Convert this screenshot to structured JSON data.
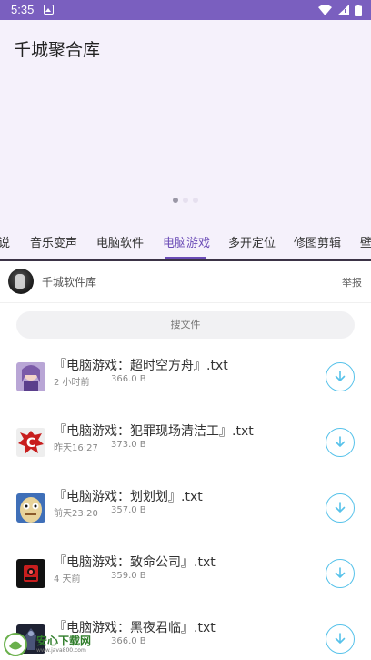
{
  "status_bar": {
    "time": "5:35",
    "icons": [
      "notification-icon",
      "wifi-icon",
      "signal-icon",
      "battery-icon"
    ]
  },
  "app": {
    "title": "千城聚合库"
  },
  "carousel": {
    "page_count": 3,
    "active_index": 0
  },
  "tabs": [
    {
      "label": "说",
      "active": false
    },
    {
      "label": "音乐变声",
      "active": false
    },
    {
      "label": "电脑软件",
      "active": false
    },
    {
      "label": "电脑游戏",
      "active": true
    },
    {
      "label": "多开定位",
      "active": false
    },
    {
      "label": "修图剪辑",
      "active": false
    },
    {
      "label": "壁",
      "active": false
    }
  ],
  "profile": {
    "name": "千城软件库",
    "report_label": "举报"
  },
  "search": {
    "placeholder": "搜文件"
  },
  "files": [
    {
      "name": "『电脑游戏：超时空方舟』.txt",
      "time": "2 小时前",
      "size": "366.0 B",
      "icon": "anime-girl-thumbnail"
    },
    {
      "name": "『电脑游戏：犯罪现场清洁工』.txt",
      "time": "昨天16:27",
      "size": "373.0 B",
      "icon": "red-c-splatter-thumbnail"
    },
    {
      "name": "『电脑游戏：划划划』.txt",
      "time": "前天23:20",
      "size": "357.0 B",
      "icon": "cartoon-face-thumbnail"
    },
    {
      "name": "『电脑游戏：致命公司』.txt",
      "time": "4 天前",
      "size": "359.0 B",
      "icon": "red-robot-thumbnail"
    },
    {
      "name": "『电脑游戏：黑夜君临』.txt",
      "time": "",
      "size": "366.0 B",
      "icon": "dark-knight-thumbnail"
    }
  ],
  "watermark": {
    "title": "安心下载网",
    "url": "www.java800.com"
  },
  "colors": {
    "status_bar": "#7a5fbf",
    "header_bg": "#f5f1fb",
    "accent": "#6a4bb6",
    "download_icon": "#57c2ea"
  }
}
